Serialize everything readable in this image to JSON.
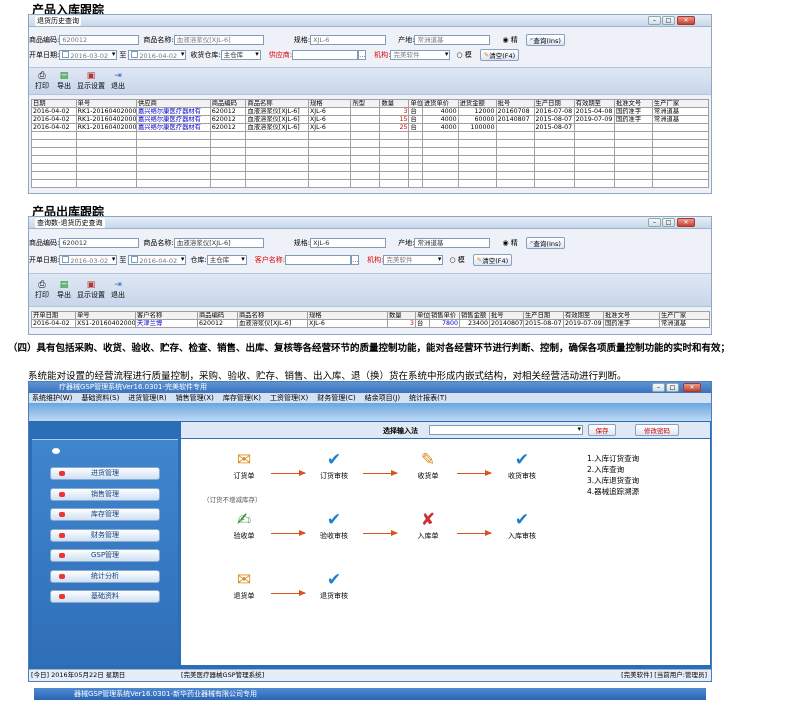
{
  "inbound": {
    "heading": "产品入库跟踪",
    "window_title": "退货历史查询",
    "row1": {
      "code_label": "商品编码:",
      "code_value": "620012",
      "name_label": "商品名称:",
      "name_value": "血液溶浆仪[XJL-6]",
      "spec_label": "规格:",
      "spec_value": "XJL-6",
      "origin_label": "产地:",
      "origin_value": "常洲道基",
      "radio1": "精",
      "query_button": "查询(Ins)"
    },
    "row2": {
      "date_label": "开单日期:",
      "date_from": "2016-03-02",
      "to_label": "至",
      "date_to": "2016-04-02",
      "warehouse_label": "收货仓库:",
      "warehouse_value": "主仓库",
      "supplier_label": "供应商:",
      "org_label": "机构:",
      "org_value": "完美软件",
      "radio2": "模",
      "clear_button": "清空(F4)"
    },
    "toolbar": [
      "打印",
      "导出",
      "显示设置",
      "退出"
    ],
    "columns": [
      "日期",
      "单号",
      "供应商",
      "商品编码",
      "商品名称",
      "规格",
      "剂型",
      "数量",
      "单位",
      "进货单价",
      "进货金额",
      "批号",
      "生产日期",
      "有效期至",
      "批准文号",
      "生产厂家"
    ],
    "rows": [
      [
        "2016-04-02",
        "RK1-201604020003",
        "嘉兴络尔康医疗器材有",
        "620012",
        "血液溶浆仪[XJL-6]",
        "XJL-6",
        "",
        "3",
        "台",
        "4000",
        "12000",
        "20160708",
        "2016-07-08",
        "2015-04-08",
        "国药准字",
        "常洲道基"
      ],
      [
        "2016-04-02",
        "RK1-201604020002",
        "嘉兴络尔康医疗器材有",
        "620012",
        "血液溶浆仪[XJL-6]",
        "XJL-6",
        "",
        "15",
        "台",
        "4000",
        "60000",
        "20140807",
        "2015-08-07",
        "2019-07-09",
        "国药准字",
        "常洲道基"
      ],
      [
        "2016-04-02",
        "RK1-201604020001",
        "嘉兴络尔康医疗器材有",
        "620012",
        "血液溶浆仪[XJL-6]",
        "XJL-6",
        "",
        "25",
        "台",
        "4000",
        "100000",
        "",
        "2015-08-07",
        "",
        "",
        ""
      ]
    ]
  },
  "outbound": {
    "heading": "产品出库跟踪",
    "window_title": "查询数-退货历史查询",
    "row1": {
      "code_label": "商品编码:",
      "code_value": "620012",
      "name_label": "商品名称:",
      "name_value": "血液溶浆仪[XJL-6]",
      "spec_label": "规格:",
      "spec_value": "XJL-6",
      "origin_label": "产地:",
      "origin_value": "常洲道基",
      "radio1": "精",
      "query_button": "查询(Ins)"
    },
    "row2": {
      "date_label": "开单日期:",
      "date_from": "2016-03-02",
      "to_label": "至",
      "date_to": "2016-04-02",
      "warehouse_label": "仓库:",
      "warehouse_value": "主仓库",
      "customer_label": "客户名称:",
      "org_label": "机构:",
      "org_value": "完美软件",
      "radio2": "模",
      "clear_button": "清空(F4)"
    },
    "toolbar": [
      "打印",
      "导出",
      "显示设置",
      "退出"
    ],
    "columns": [
      "开单日期",
      "单号",
      "客户名称",
      "商品编码",
      "商品名称",
      "规格",
      "数量",
      "单位",
      "销售单价",
      "销售金额",
      "批号",
      "生产日期",
      "有效期至",
      "批准文号",
      "生产厂家"
    ],
    "rows": [
      [
        "2016-04-02",
        "XS1-201604020001",
        "天津兰博",
        "620012",
        "血液溶浆仪[XJL-6]",
        "XJL-6",
        "3",
        "台",
        "7800",
        "23400",
        "20140807",
        "2015-08-07",
        "2019-07-09",
        "国药准字",
        "常洲道基"
      ]
    ]
  },
  "text": {
    "heading": "（四）具有包括采购、收货、验收、贮存、检查、销售、出库、复核等各经营环节的质量控制功能，能对各经营环节进行判断、控制，确保各项质量控制功能的实时和有效；",
    "body": "系统能对设置的经营流程进行质量控制，采购、验收、贮存、销售、出入库、退（换）货在系统中形成内嵌式结构，对相关经营活动进行判断。"
  },
  "gsp": {
    "title": "疗器械GSP管理系统Ver16.0301-完美软件专用",
    "menu": [
      "系统维护(W)",
      "基础资料(S)",
      "进货管理(R)",
      "销售管理(X)",
      "库存管理(K)",
      "工资管理(X)",
      "财务管理(C)",
      "结余项目(J)",
      "统计报表(T)"
    ],
    "select_label": "选择输入法",
    "save_button": "保存",
    "password_button": "修改密码",
    "sidebar": [
      "进货管理",
      "销售管理",
      "库存管理",
      "财务管理",
      "GSP管理",
      "统计分析",
      "基础资料"
    ],
    "flow": [
      "订货单",
      "订货审核",
      "收货单",
      "收货审核",
      "验收单",
      "验收审核",
      "入库单",
      "入库审核",
      "退货单",
      "退货审核"
    ],
    "flow_note": "（订货不增减库存）",
    "links": [
      "1.入库订货查询",
      "2.入库查询",
      "3.入库退货查询",
      "4.器械追踪溯源"
    ],
    "status_left": "[今日] 2016年05月22日 星期日",
    "status_mid": "[完美医疗器械GSP管理系统]",
    "status_right": "[完美软件] [当前用户:管理员]"
  },
  "taskbar": "器械GSP管理系统Ver16.0301-新华药业器械有限公司专用"
}
